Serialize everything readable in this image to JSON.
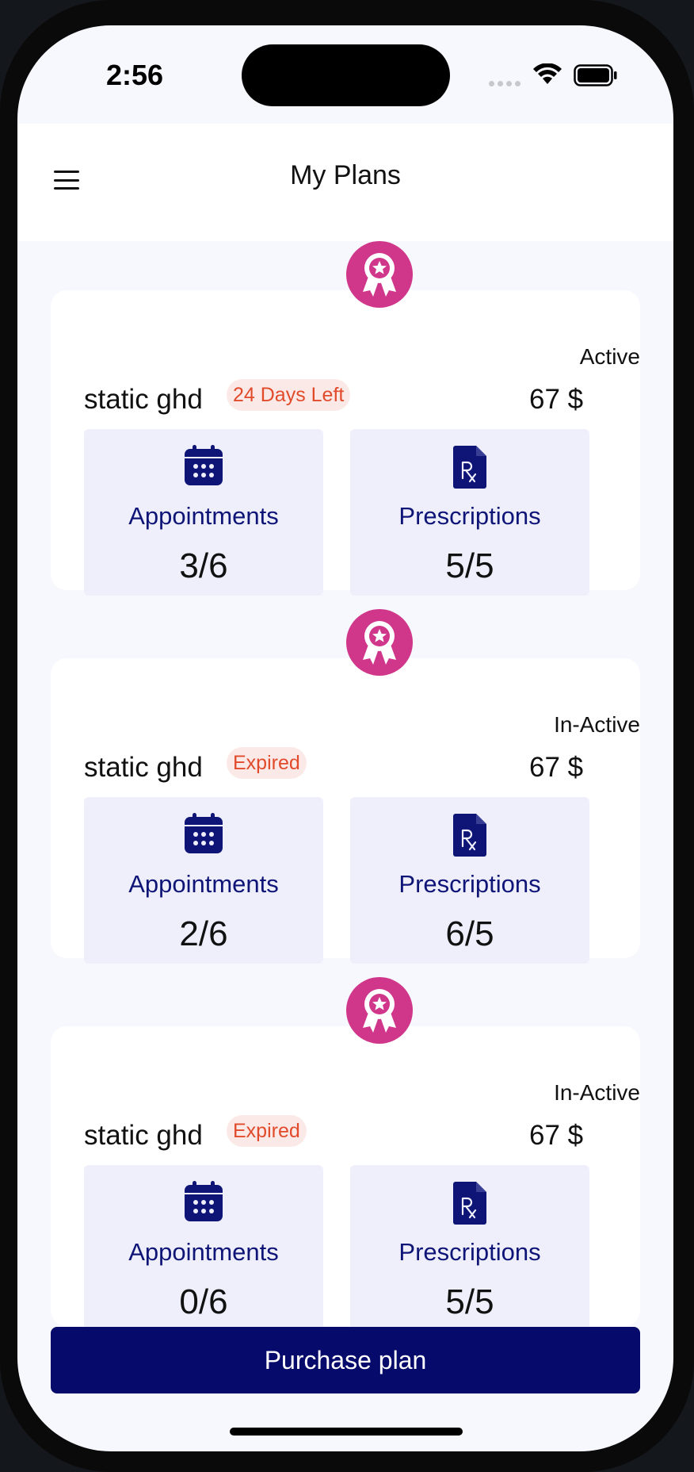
{
  "status_bar": {
    "time": "2:56"
  },
  "header": {
    "title": "My Plans"
  },
  "plans": [
    {
      "name": "static ghd",
      "badge": "24 Days Left",
      "status": "Active",
      "price": "67 $",
      "appointments_label": "Appointments",
      "appointments_value": "3/6",
      "prescriptions_label": "Prescriptions",
      "prescriptions_value": "5/5"
    },
    {
      "name": "static ghd",
      "badge": "Expired",
      "status": "In-Active",
      "price": "67 $",
      "appointments_label": "Appointments",
      "appointments_value": "2/6",
      "prescriptions_label": "Prescriptions",
      "prescriptions_value": "6/5"
    },
    {
      "name": "static ghd",
      "badge": "Expired",
      "status": "In-Active",
      "price": "67 $",
      "appointments_label": "Appointments",
      "appointments_value": "0/6",
      "prescriptions_label": "Prescriptions",
      "prescriptions_value": "5/5"
    }
  ],
  "purchase_button": {
    "label": "Purchase plan"
  },
  "colors": {
    "accent_navy": "#060a6b",
    "medal_pink": "#d0368a",
    "badge_red": "#e14b2b",
    "stat_bg": "#efeffb"
  },
  "icons": {
    "menu": "hamburger-menu-icon",
    "medal": "award-medal-icon",
    "appointments": "calendar-icon",
    "prescriptions": "prescription-rx-icon"
  }
}
